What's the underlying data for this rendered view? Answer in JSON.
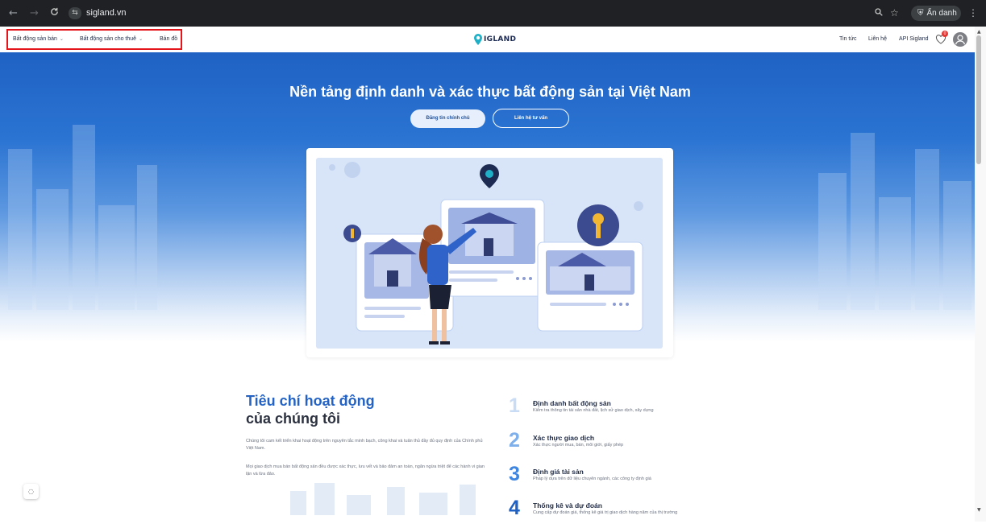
{
  "browser": {
    "back_icon": "←",
    "forward_icon": "→",
    "reload_icon": "C",
    "tune_icon": "⇆",
    "url": "sigland.vn",
    "zoom_icon": "🔍",
    "star_icon": "☆",
    "incognito_label": "Ẩn danh",
    "incognito_icon": "⛨",
    "menu_icon": "⋮"
  },
  "header": {
    "nav": [
      {
        "label": "Bất động sản bán",
        "chevron": "⌄"
      },
      {
        "label": "Bất động sản cho thuê",
        "chevron": "⌄"
      },
      {
        "label": "Bản đồ"
      }
    ],
    "logo_text": "IGLAND",
    "right_links": [
      "Tin tức",
      "Liên hệ",
      "API Sigland"
    ],
    "favorites_count": "0",
    "accent_color": "#2463c4",
    "highlight_color": "#e4151b"
  },
  "hero": {
    "title": "Nền tảng định danh và xác thực bất động sản tại Việt Nam",
    "primary_button": "Đăng tin chính chủ",
    "secondary_button": "Liên hệ tư vấn"
  },
  "criteria": {
    "title_line1": "Tiêu chí hoạt động",
    "title_line2": "của chúng tôi",
    "paragraph1": "Chúng tôi cam kết triển khai hoạt động trên nguyên tắc minh bạch, công khai và tuân thủ đầy đủ quy định của Chính phủ Việt Nam.",
    "paragraph2": "Mọi giao dịch mua bán bất động sản đều được xác thực, lưu vết và bảo đảm an toàn, ngăn ngừa triệt để các hành vi gian lận và lừa đảo.",
    "items": [
      {
        "number": "1",
        "title": "Định danh bất động sản",
        "desc": "Kiểm tra thông tin tài sản nhà đất, lịch sử giao dịch, xây dựng",
        "color": "#c9dcf6"
      },
      {
        "number": "2",
        "title": "Xác thực giao dịch",
        "desc": "Xác thực người mua, bán, môi giới, giấy phép",
        "color": "#7fb0ec"
      },
      {
        "number": "3",
        "title": "Định giá tài sản",
        "desc": "Pháp lý dựa trên dữ liệu chuyên ngành, các công ty định giá",
        "color": "#3f86e0"
      },
      {
        "number": "4",
        "title": "Thống kê và dự đoán",
        "desc": "Cung cấp dự đoán giá, thống kê giá trị giao dịch hàng năm của thị trường",
        "color": "#1f62c4"
      }
    ]
  },
  "chat_icon": "◌"
}
